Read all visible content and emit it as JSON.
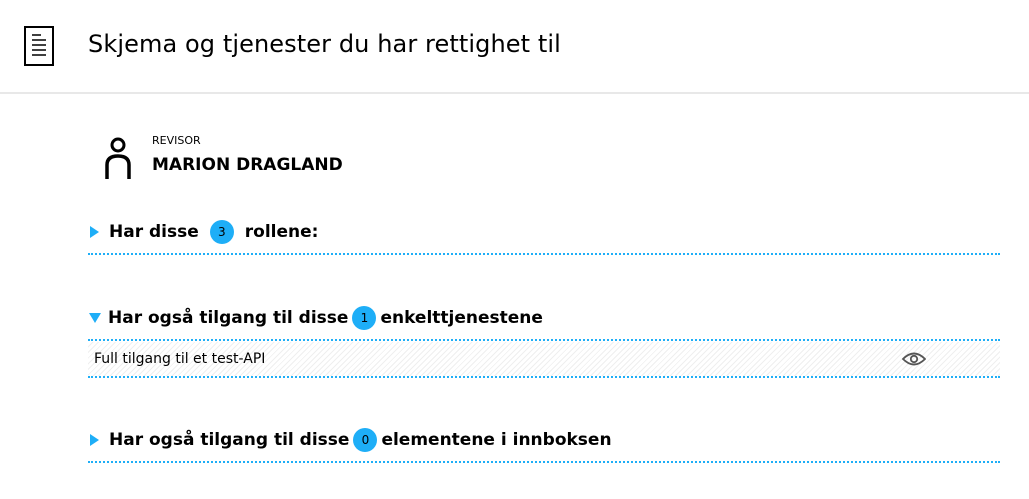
{
  "header": {
    "title": "Skjema og tjenester du har rettighet til",
    "icon": "document-icon"
  },
  "person": {
    "role": "REVISOR",
    "name": "MARION DRAGLAND",
    "icon": "person-icon"
  },
  "sections": [
    {
      "prefix": "Har disse",
      "count": "3",
      "suffix": "rollene:",
      "expanded": false
    },
    {
      "prefix": "Har også tilgang til disse",
      "count": "1",
      "suffix": "enkelttjenestene",
      "expanded": true,
      "items": [
        {
          "label": "Full tilgang til et test-API",
          "icon": "eye-icon"
        }
      ]
    },
    {
      "prefix": "Har også tilgang til disse",
      "count": "0",
      "suffix": "elementene i innboksen",
      "expanded": false
    }
  ],
  "colors": {
    "accent": "#1eaef7",
    "header_border": "#e8e8e8"
  }
}
